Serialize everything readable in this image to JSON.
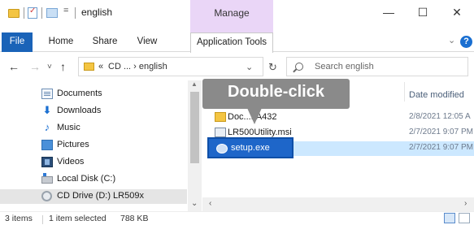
{
  "window": {
    "title": "english",
    "quick_access_dropdown": "=",
    "manage_label": "Manage",
    "controls": {
      "minimize": "—",
      "maximize": "☐",
      "close": "✕"
    }
  },
  "ribbon": {
    "tabs": [
      "File",
      "Home",
      "Share",
      "View",
      "Application Tools"
    ],
    "file_tab_color": "#1a63b8",
    "manage_color": "#ead6f7",
    "help": "?"
  },
  "address": {
    "back": "←",
    "forward": "→",
    "recent": "˅",
    "up": "↑",
    "prefix": "«",
    "path": "CD ... › english",
    "dropdown": "⌄",
    "refresh": "↻",
    "search_placeholder": "Search english"
  },
  "nav_pane": {
    "items": [
      {
        "label": "Documents",
        "icon": "documents-icon"
      },
      {
        "label": "Downloads",
        "icon": "downloads-icon"
      },
      {
        "label": "Music",
        "icon": "music-icon"
      },
      {
        "label": "Pictures",
        "icon": "pictures-icon"
      },
      {
        "label": "Videos",
        "icon": "videos-icon"
      },
      {
        "label": "Local Disk (C:)",
        "icon": "local-disk-icon"
      },
      {
        "label": "CD Drive (D:) LR509x",
        "icon": "cd-drive-icon"
      }
    ]
  },
  "files": {
    "column_header": "Date modified",
    "rows": [
      {
        "name": "Doc...FA432",
        "date": "2/8/2021 12:05 A",
        "icon": "folder-icon"
      },
      {
        "name": "LR500Utility.msi",
        "date": "2/7/2021 9:07 PM",
        "icon": "msi-file-icon"
      },
      {
        "name": "setup.exe",
        "date": "2/7/2021 9:07 PM",
        "icon": "setup-exe-icon"
      }
    ]
  },
  "callout": {
    "text": "Double-click"
  },
  "status": {
    "items_count": "3 items",
    "selection": "1 item selected",
    "size": "788 KB"
  }
}
